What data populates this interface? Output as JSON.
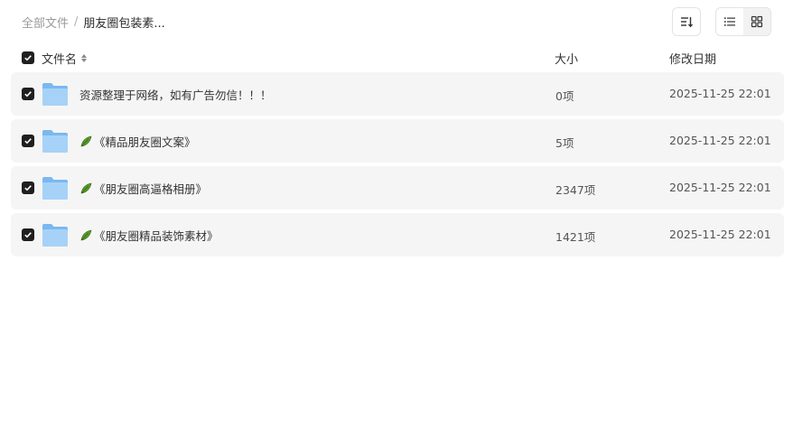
{
  "breadcrumb": {
    "root": "全部文件",
    "separator": "/",
    "current": "朋友圈包装素..."
  },
  "toolbar": {
    "sort_icon": "sort-icon",
    "list_view_icon": "list-view-icon",
    "grid_view_icon": "grid-view-icon",
    "active_view": "grid"
  },
  "table": {
    "columns": {
      "name": "文件名",
      "size": "大小",
      "date": "修改日期"
    },
    "rows": [
      {
        "name": "资源整理于网络，如有广告勿信！！！",
        "size": "0项",
        "date": "2025-11-25 22:01",
        "leaf": false,
        "checked": true
      },
      {
        "name": "《精品朋友圈文案》",
        "size": "5项",
        "date": "2025-11-25 22:01",
        "leaf": true,
        "checked": true
      },
      {
        "name": "《朋友圈高逼格相册》",
        "size": "2347项",
        "date": "2025-11-25 22:01",
        "leaf": true,
        "checked": true
      },
      {
        "name": "《朋友圈精品装饰素材》",
        "size": "1421项",
        "date": "2025-11-25 22:01",
        "leaf": true,
        "checked": true
      }
    ]
  },
  "colors": {
    "checkbox": "#1f1f1f",
    "row_bg": "#f5f5f5",
    "folder": "#8cc4f3"
  }
}
